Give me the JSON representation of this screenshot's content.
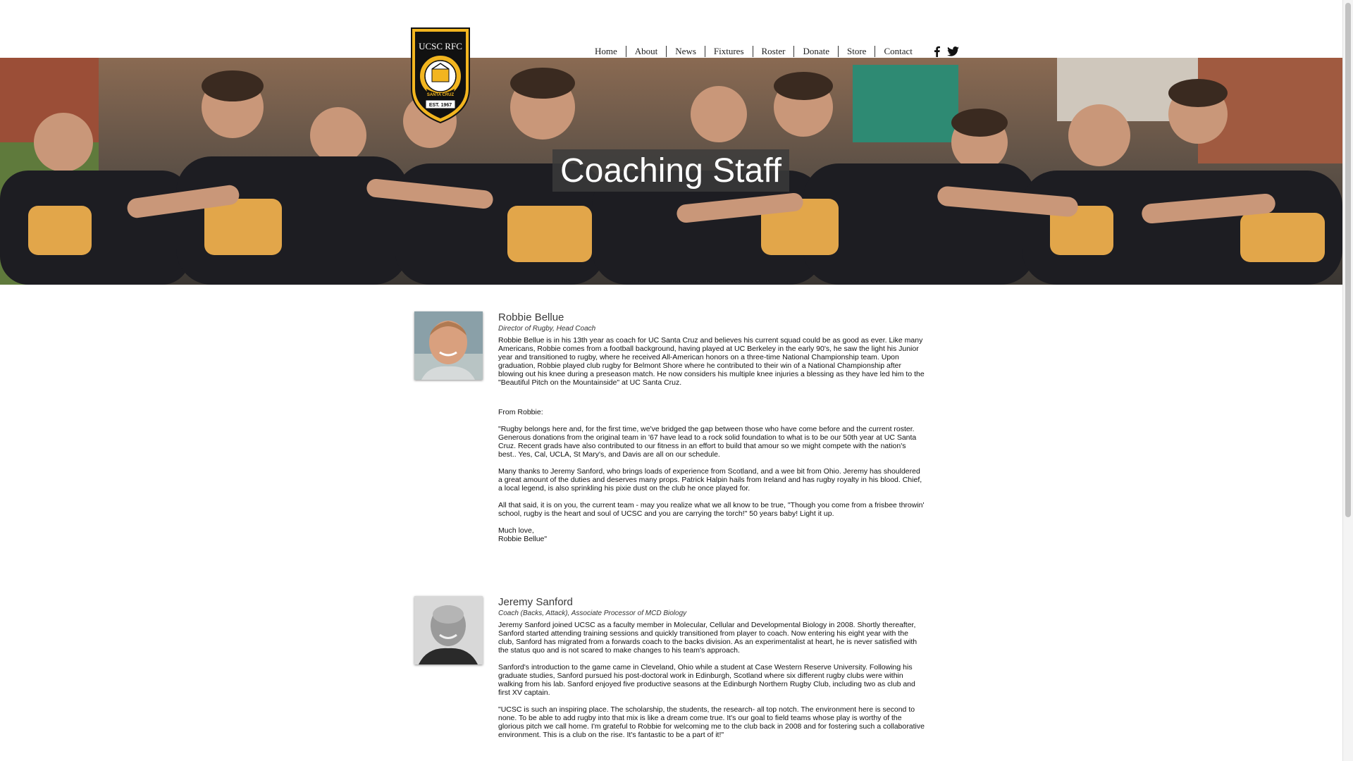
{
  "logo": {
    "ring_text": "UCSC RFC",
    "banner_text": "SANTA CRUZ",
    "est_text": "EST. 1967",
    "colors": {
      "gold": "#f2b51f",
      "black": "#111111"
    }
  },
  "nav": {
    "items": [
      "Home",
      "About",
      "News",
      "Fixtures",
      "Roster",
      "Donate",
      "Store",
      "Contact"
    ],
    "social": [
      "facebook-icon",
      "twitter-icon"
    ]
  },
  "hero": {
    "title": "Coaching Staff"
  },
  "coaches": [
    {
      "name": "Robbie Bellue",
      "role": "Director of Rugby, Head Coach",
      "paragraphs": [
        "Robbie Bellue is in his 13th year as coach for UC Santa Cruz and believes his current squad could be as good as ever. Like many Americans, Robbie comes from a football background, having played at UC Berkeley in the early 90's, he saw the light his Junior year and transitioned to rugby, where he received All-American honors on a three-time National Championship team. Upon graduation, Robbie played club rugby for Belmont Shore where he contributed to their win of a National Championship after blowing out his knee during a preseason match. He now considers his multiple knee injuries a blessing as they have led him to the \"Beautiful Pitch on the Mountainside\" at UC Santa Cruz.",
        "From Robbie:",
        "\"Rugby belongs here and, for the first time, we've bridged the gap between those who have come before and the current roster. Generous donations from the original team in '67 have lead to a rock solid foundation to what is to be our 50th year at UC Santa Cruz. Recent grads have also contributed to our fitness in an effort to build that amour so we might compete with the nation's best.. Yes, Cal, UCLA, St Mary's, and Davis are all on our schedule.",
        "Many thanks to Jeremy Sanford, who brings loads of experience from Scotland, and a wee bit from Ohio. Jeremy has shouldered a great amount of the duties and deserves many props. Patrick Halpin hails from Ireland and has rugby royalty in his blood. Chief, a local legend, is also sprinkling his pixie dust on the club he once played for.",
        "All that said, it is on you, the current team - may you realize what we all know to be true, \"Though you come from a frisbee throwin' school, rugby is the heart and soul of UCSC and you are carrying the torch!\" 50 years baby! Light it up."
      ],
      "signoff_1": "Much love,",
      "signoff_2": "Robbie Bellue\""
    },
    {
      "name": "Jeremy Sanford",
      "role": "Coach (Backs, Attack), Associate Processor of MCD Biology",
      "paragraphs": [
        "Jeremy Sanford joined UCSC as a faculty member in Molecular, Cellular and Developmental Biology in 2008. Shortly thereafter, Sanford started attending training sessions and quickly transitioned from player to coach. Now entering his eight year with the club, Sanford has migrated from a forwards coach to the backs division. As an experimentalist at heart, he is never satisfied with the status quo and is not scared to make changes to his team's approach.",
        "Sanford's introduction to the game came in Cleveland, Ohio while a student at Case Western Reserve University. Following his graduate studies, Sanford pursued his post-doctoral work in Edinburgh, Scotland where six different rugby clubs were within walking from his lab. Sanford enjoyed five productive seasons at the Edinburgh Northern Rugby Club, including two as club and first XV captain.",
        "\"UCSC is such an inspiring place. The scholarship, the students, the research- all top notch. The environment here is second to none. To be able to add rugby into that mix is like a dream come true. It's our goal to field teams whose play is worthy of the glorious pitch we call home. I'm grateful to Robbie for welcoming me to the club back in 2008 and for fostering such a collaborative environment. This is a club on the rise. It's fantastic to be a part of it!\""
      ]
    }
  ]
}
